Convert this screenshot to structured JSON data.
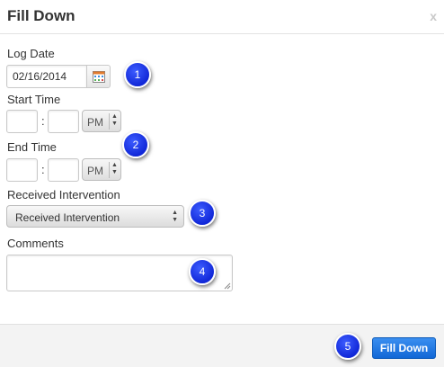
{
  "dialog": {
    "title": "Fill Down",
    "close_label": "x"
  },
  "log_date": {
    "label": "Log Date",
    "value": "02/16/2014"
  },
  "start_time": {
    "label": "Start Time",
    "hour": "",
    "minute": "",
    "separator": ":",
    "meridiem": "PM"
  },
  "end_time": {
    "label": "End Time",
    "hour": "",
    "minute": "",
    "separator": ":",
    "meridiem": "PM"
  },
  "received_intervention": {
    "label": "Received Intervention",
    "selected": "Received Intervention"
  },
  "comments": {
    "label": "Comments",
    "value": ""
  },
  "footer": {
    "submit_label": "Fill Down"
  },
  "callouts": [
    "1",
    "2",
    "3",
    "4",
    "5"
  ],
  "colors": {
    "callout": "#1f3be8",
    "primary_button": "#1a72e0"
  }
}
